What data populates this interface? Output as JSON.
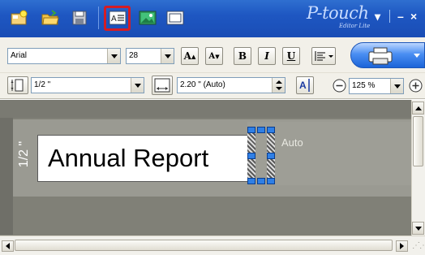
{
  "titlebar": {
    "brand": "P-touch",
    "brand_sub": "Editor Lite",
    "minimize": "–",
    "close": "×",
    "menu_arrow": "▾",
    "icons": [
      "new-label-icon",
      "open-folder-icon",
      "save-icon",
      "insert-text-icon",
      "insert-image-icon",
      "frame-icon"
    ],
    "highlight_color": "#d51c24",
    "accent": "#1e57c2"
  },
  "format": {
    "font_name": "Arial",
    "font_size": "28",
    "bold": "B",
    "italic": "I",
    "underline": "U",
    "grow_font": "A",
    "shrink_font": "A"
  },
  "layout": {
    "margin_value": "1/2 \"",
    "length_value": "2.20 \" (Auto)",
    "zoom_value": "125 %"
  },
  "canvas": {
    "margin_label": "1/2 \"",
    "auto_label": "Auto",
    "text": "Annual Report"
  }
}
